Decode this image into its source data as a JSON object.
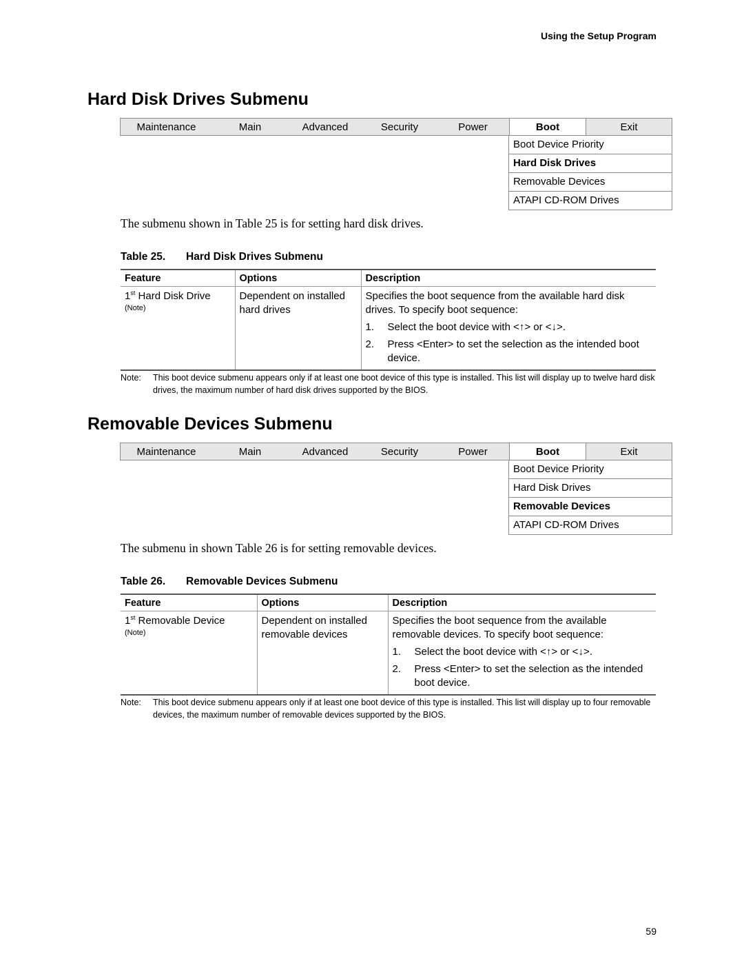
{
  "running_head": "Using the Setup Program",
  "page_number": "59",
  "menu_tabs": [
    "Maintenance",
    "Main",
    "Advanced",
    "Security",
    "Power",
    "Boot",
    "Exit"
  ],
  "sections": [
    {
      "title": "Hard Disk Drives Submenu",
      "active_tab": "Boot",
      "submenu_items": [
        {
          "label": "Boot Device Priority",
          "active": false
        },
        {
          "label": "Hard Disk Drives",
          "active": true
        },
        {
          "label": "Removable Devices",
          "active": false
        },
        {
          "label": "ATAPI CD-ROM Drives",
          "active": false
        }
      ],
      "intro": "The submenu shown in Table 25 is for setting hard disk drives.",
      "table": {
        "caption_number": "Table 25.",
        "caption_title": "Hard Disk Drives Submenu",
        "headers": [
          "Feature",
          "Options",
          "Description"
        ],
        "row": {
          "feature_ordinal": "1",
          "feature_sup": "st",
          "feature_name": " Hard Disk Drive",
          "feature_note": "(Note)",
          "options": "Dependent on installed hard drives",
          "description": "Specifies the boot sequence from the available hard disk drives.  To specify boot sequence:",
          "steps": [
            {
              "num": "1.",
              "text": "Select the boot device with <↑> or <↓>."
            },
            {
              "num": "2.",
              "text": "Press <Enter> to set the selection as the intended boot device."
            }
          ]
        }
      },
      "note_label": "Note:",
      "note_text": "This boot device submenu appears only if at least one boot device of this type is installed.  This list will display up to twelve hard disk drives, the maximum number of hard disk drives supported by the BIOS."
    },
    {
      "title": "Removable Devices Submenu",
      "active_tab": "Boot",
      "submenu_items": [
        {
          "label": "Boot Device Priority",
          "active": false
        },
        {
          "label": "Hard Disk Drives",
          "active": false
        },
        {
          "label": "Removable Devices",
          "active": true
        },
        {
          "label": "ATAPI CD-ROM Drives",
          "active": false
        }
      ],
      "intro": "The submenu in shown Table 26 is for setting removable devices.",
      "table": {
        "caption_number": "Table 26.",
        "caption_title": "Removable Devices Submenu",
        "headers": [
          "Feature",
          "Options",
          "Description"
        ],
        "row": {
          "feature_ordinal": "1",
          "feature_sup": "st",
          "feature_name": " Removable Device",
          "feature_note": "(Note)",
          "options": "Dependent on installed removable devices",
          "description": "Specifies the boot sequence from the available removable devices.  To specify boot sequence:",
          "steps": [
            {
              "num": "1.",
              "text": "Select the boot device with <↑> or <↓>."
            },
            {
              "num": "2.",
              "text": "Press <Enter> to set the selection as the intended boot device."
            }
          ]
        }
      },
      "note_label": "Note:",
      "note_text": "This boot device submenu appears only if at least one boot device of this type is installed.  This list will display up to four removable devices, the maximum number of removable devices supported by the BIOS."
    }
  ]
}
